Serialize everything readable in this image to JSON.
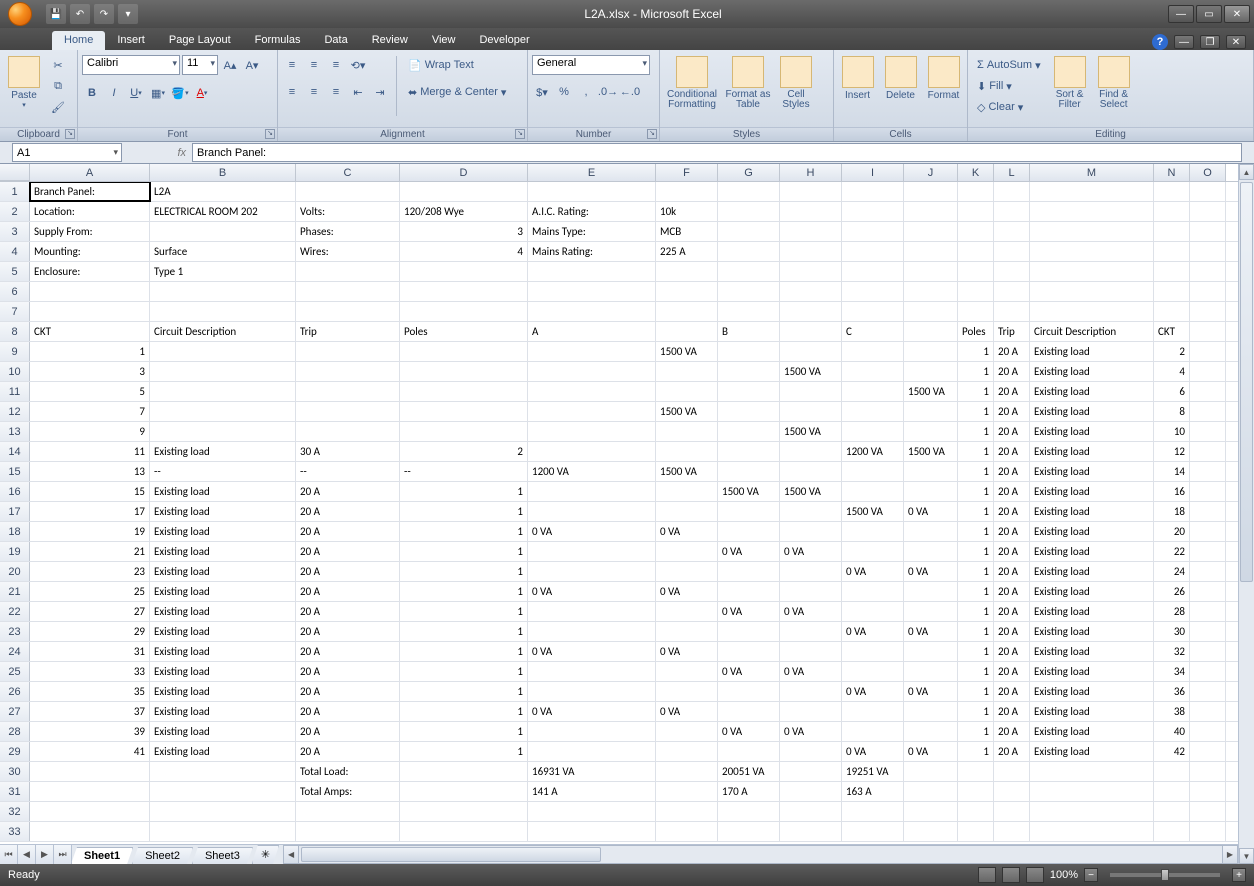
{
  "title": "L2A.xlsx - Microsoft Excel",
  "tabs": [
    "Home",
    "Insert",
    "Page Layout",
    "Formulas",
    "Data",
    "Review",
    "View",
    "Developer"
  ],
  "activeTab": "Home",
  "ribbon": {
    "clipboard": {
      "title": "Clipboard",
      "paste": "Paste"
    },
    "font": {
      "title": "Font",
      "name": "Calibri",
      "size": "11"
    },
    "alignment": {
      "title": "Alignment",
      "wrap": "Wrap Text",
      "merge": "Merge & Center"
    },
    "number": {
      "title": "Number",
      "format": "General"
    },
    "styles": {
      "title": "Styles",
      "cond": "Conditional Formatting",
      "table": "Format as Table",
      "cell": "Cell Styles"
    },
    "cells": {
      "title": "Cells",
      "insert": "Insert",
      "delete": "Delete",
      "format": "Format"
    },
    "editing": {
      "title": "Editing",
      "autosum": "AutoSum",
      "fill": "Fill",
      "clear": "Clear",
      "sort": "Sort & Filter",
      "find": "Find & Select"
    }
  },
  "namebox": "A1",
  "formula": "Branch Panel:",
  "columns": [
    {
      "id": "A",
      "w": 120
    },
    {
      "id": "B",
      "w": 146
    },
    {
      "id": "C",
      "w": 104
    },
    {
      "id": "D",
      "w": 128
    },
    {
      "id": "E",
      "w": 128
    },
    {
      "id": "F",
      "w": 62
    },
    {
      "id": "G",
      "w": 62
    },
    {
      "id": "H",
      "w": 62
    },
    {
      "id": "I",
      "w": 62
    },
    {
      "id": "J",
      "w": 54
    },
    {
      "id": "K",
      "w": 36
    },
    {
      "id": "L",
      "w": 36
    },
    {
      "id": "M",
      "w": 124
    },
    {
      "id": "N",
      "w": 36
    },
    {
      "id": "O",
      "w": 36
    }
  ],
  "rows": [
    {
      "n": 1,
      "c": {
        "A": "Branch Panel:",
        "B": "L2A"
      }
    },
    {
      "n": 2,
      "c": {
        "A": "Location:",
        "B": "ELECTRICAL ROOM 202",
        "C": "Volts:",
        "D": "120/208 Wye",
        "E": "A.I.C. Rating:",
        "F": "10k"
      }
    },
    {
      "n": 3,
      "c": {
        "A": "Supply From:",
        "C": "Phases:",
        "E": "Mains Type:",
        "F": "MCB"
      },
      "r": {
        "D": "3"
      }
    },
    {
      "n": 4,
      "c": {
        "A": "Mounting:",
        "B": "Surface",
        "C": "Wires:",
        "E": "Mains Rating:",
        "F": "225 A"
      },
      "r": {
        "D": "4"
      }
    },
    {
      "n": 5,
      "c": {
        "A": "Enclosure:",
        "B": "Type 1"
      }
    },
    {
      "n": 6,
      "c": {}
    },
    {
      "n": 7,
      "c": {}
    },
    {
      "n": 8,
      "c": {
        "A": "CKT",
        "B": "Circuit Description",
        "C": "Trip",
        "D": "Poles",
        "E": "A",
        "G": "B",
        "I": "C",
        "K": "Poles",
        "L": "Trip",
        "M": "Circuit Description",
        "N": "CKT"
      }
    },
    {
      "n": 9,
      "c": {
        "F": "1500 VA",
        "L": "20 A",
        "M": "Existing load"
      },
      "r": {
        "A": "1",
        "K": "1",
        "N": "2"
      }
    },
    {
      "n": 10,
      "c": {
        "H": "1500 VA",
        "L": "20 A",
        "M": "Existing load"
      },
      "r": {
        "A": "3",
        "K": "1",
        "N": "4"
      }
    },
    {
      "n": 11,
      "c": {
        "J": "1500 VA",
        "L": "20 A",
        "M": "Existing load"
      },
      "r": {
        "A": "5",
        "K": "1",
        "N": "6"
      }
    },
    {
      "n": 12,
      "c": {
        "F": "1500 VA",
        "L": "20 A",
        "M": "Existing load"
      },
      "r": {
        "A": "7",
        "K": "1",
        "N": "8"
      }
    },
    {
      "n": 13,
      "c": {
        "H": "1500 VA",
        "L": "20 A",
        "M": "Existing load"
      },
      "r": {
        "A": "9",
        "K": "1",
        "N": "10"
      }
    },
    {
      "n": 14,
      "c": {
        "B": "Existing load",
        "C": "30 A",
        "I": "1200 VA",
        "J": "1500 VA",
        "L": "20 A",
        "M": "Existing load"
      },
      "r": {
        "A": "11",
        "D": "2",
        "K": "1",
        "N": "12"
      }
    },
    {
      "n": 15,
      "c": {
        "B": "--",
        "C": "--",
        "D": "--",
        "E": "1200 VA",
        "F": "1500 VA",
        "L": "20 A",
        "M": "Existing load"
      },
      "r": {
        "A": "13",
        "K": "1",
        "N": "14"
      }
    },
    {
      "n": 16,
      "c": {
        "B": "Existing load",
        "C": "20 A",
        "G": "1500 VA",
        "H": "1500 VA",
        "L": "20 A",
        "M": "Existing load"
      },
      "r": {
        "A": "15",
        "D": "1",
        "K": "1",
        "N": "16"
      }
    },
    {
      "n": 17,
      "c": {
        "B": "Existing load",
        "C": "20 A",
        "I": "1500 VA",
        "J": "0 VA",
        "L": "20 A",
        "M": "Existing load"
      },
      "r": {
        "A": "17",
        "D": "1",
        "K": "1",
        "N": "18"
      }
    },
    {
      "n": 18,
      "c": {
        "B": "Existing load",
        "C": "20 A",
        "E": "0 VA",
        "F": "0 VA",
        "L": "20 A",
        "M": "Existing load"
      },
      "r": {
        "A": "19",
        "D": "1",
        "K": "1",
        "N": "20"
      }
    },
    {
      "n": 19,
      "c": {
        "B": "Existing load",
        "C": "20 A",
        "G": "0 VA",
        "H": "0 VA",
        "L": "20 A",
        "M": "Existing load"
      },
      "r": {
        "A": "21",
        "D": "1",
        "K": "1",
        "N": "22"
      }
    },
    {
      "n": 20,
      "c": {
        "B": "Existing load",
        "C": "20 A",
        "I": "0 VA",
        "J": "0 VA",
        "L": "20 A",
        "M": "Existing load"
      },
      "r": {
        "A": "23",
        "D": "1",
        "K": "1",
        "N": "24"
      }
    },
    {
      "n": 21,
      "c": {
        "B": "Existing load",
        "C": "20 A",
        "E": "0 VA",
        "F": "0 VA",
        "L": "20 A",
        "M": "Existing load"
      },
      "r": {
        "A": "25",
        "D": "1",
        "K": "1",
        "N": "26"
      }
    },
    {
      "n": 22,
      "c": {
        "B": "Existing load",
        "C": "20 A",
        "G": "0 VA",
        "H": "0 VA",
        "L": "20 A",
        "M": "Existing load"
      },
      "r": {
        "A": "27",
        "D": "1",
        "K": "1",
        "N": "28"
      }
    },
    {
      "n": 23,
      "c": {
        "B": "Existing load",
        "C": "20 A",
        "I": "0 VA",
        "J": "0 VA",
        "L": "20 A",
        "M": "Existing load"
      },
      "r": {
        "A": "29",
        "D": "1",
        "K": "1",
        "N": "30"
      }
    },
    {
      "n": 24,
      "c": {
        "B": "Existing load",
        "C": "20 A",
        "E": "0 VA",
        "F": "0 VA",
        "L": "20 A",
        "M": "Existing load"
      },
      "r": {
        "A": "31",
        "D": "1",
        "K": "1",
        "N": "32"
      }
    },
    {
      "n": 25,
      "c": {
        "B": "Existing load",
        "C": "20 A",
        "G": "0 VA",
        "H": "0 VA",
        "L": "20 A",
        "M": "Existing load"
      },
      "r": {
        "A": "33",
        "D": "1",
        "K": "1",
        "N": "34"
      }
    },
    {
      "n": 26,
      "c": {
        "B": "Existing load",
        "C": "20 A",
        "I": "0 VA",
        "J": "0 VA",
        "L": "20 A",
        "M": "Existing load"
      },
      "r": {
        "A": "35",
        "D": "1",
        "K": "1",
        "N": "36"
      }
    },
    {
      "n": 27,
      "c": {
        "B": "Existing load",
        "C": "20 A",
        "E": "0 VA",
        "F": "0 VA",
        "L": "20 A",
        "M": "Existing load"
      },
      "r": {
        "A": "37",
        "D": "1",
        "K": "1",
        "N": "38"
      }
    },
    {
      "n": 28,
      "c": {
        "B": "Existing load",
        "C": "20 A",
        "G": "0 VA",
        "H": "0 VA",
        "L": "20 A",
        "M": "Existing load"
      },
      "r": {
        "A": "39",
        "D": "1",
        "K": "1",
        "N": "40"
      }
    },
    {
      "n": 29,
      "c": {
        "B": "Existing load",
        "C": "20 A",
        "I": "0 VA",
        "J": "0 VA",
        "L": "20 A",
        "M": "Existing load"
      },
      "r": {
        "A": "41",
        "D": "1",
        "K": "1",
        "N": "42"
      }
    },
    {
      "n": 30,
      "c": {
        "C": "Total Load:",
        "E": "16931 VA",
        "G": "20051 VA",
        "I": "19251 VA"
      }
    },
    {
      "n": 31,
      "c": {
        "C": "Total Amps:",
        "E": "141 A",
        "G": "170 A",
        "I": "163 A"
      }
    },
    {
      "n": 32,
      "c": {}
    },
    {
      "n": 33,
      "c": {}
    }
  ],
  "sheets": [
    "Sheet1",
    "Sheet2",
    "Sheet3"
  ],
  "activeSheet": "Sheet1",
  "status": "Ready",
  "zoom": "100%"
}
